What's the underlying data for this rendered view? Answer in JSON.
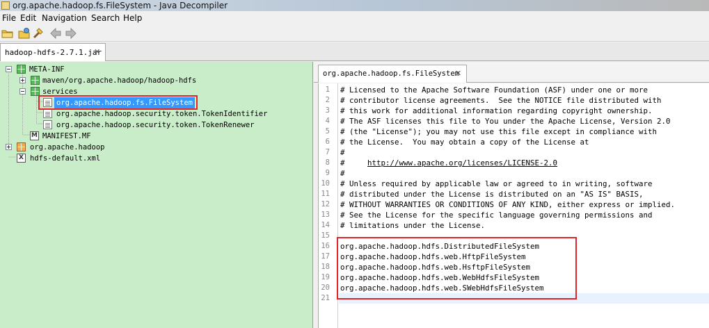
{
  "window": {
    "title": "org.apache.hadoop.fs.FileSystem - Java Decompiler"
  },
  "menu": [
    "File",
    "Edit",
    "Navigation",
    "Search",
    "Help"
  ],
  "toolbar": [
    "open-folder-icon",
    "open-type-icon",
    "search-icon",
    "back-icon",
    "forward-icon"
  ],
  "jar_tab": {
    "label": "hadoop-hdfs-2.7.1.jar",
    "close": "✕"
  },
  "tree": {
    "meta_inf": "META-INF",
    "maven": "maven/org.apache.hadoop/hadoop-hdfs",
    "services": "services",
    "services_items": [
      "org.apache.hadoop.fs.FileSystem",
      "org.apache.hadoop.security.token.TokenIdentifier",
      "org.apache.hadoop.security.token.TokenRenewer"
    ],
    "manifest": "MANIFEST.MF",
    "manifest_badge": "M",
    "org_apache_hadoop": "org.apache.hadoop",
    "hdfs_default": "hdfs-default.xml",
    "xml_badge": "X"
  },
  "editor_tab": {
    "label": "org.apache.hadoop.fs.FileSystem",
    "close": "✕"
  },
  "code_lines": [
    "# Licensed to the Apache Software Foundation (ASF) under one or more",
    "# contributor license agreements.  See the NOTICE file distributed with",
    "# this work for additional information regarding copyright ownership.",
    "# The ASF licenses this file to You under the Apache License, Version 2.0",
    "# (the \"License\"); you may not use this file except in compliance with",
    "# the License.  You may obtain a copy of the License at",
    "#",
    "#     http://www.apache.org/licenses/LICENSE-2.0",
    "#",
    "# Unless required by applicable law or agreed to in writing, software",
    "# distributed under the License is distributed on an \"AS IS\" BASIS,",
    "# WITHOUT WARRANTIES OR CONDITIONS OF ANY KIND, either express or implied.",
    "# See the License for the specific language governing permissions and",
    "# limitations under the License.",
    "",
    "org.apache.hadoop.hdfs.DistributedFileSystem",
    "org.apache.hadoop.hdfs.web.HftpFileSystem",
    "org.apache.hadoop.hdfs.web.HsftpFileSystem",
    "org.apache.hadoop.hdfs.web.WebHdfsFileSystem",
    "org.apache.hadoop.hdfs.web.SWebHdfsFileSystem",
    ""
  ],
  "line_numbers": [
    "1",
    "2",
    "3",
    "4",
    "5",
    "6",
    "7",
    "8",
    "9",
    "10",
    "11",
    "12",
    "13",
    "14",
    "15",
    "16",
    "17",
    "18",
    "19",
    "20",
    "21"
  ],
  "link_url": "http://www.apache.org/licenses/LICENSE-2.0",
  "colors": {
    "tree_bg": "#c9ecc9",
    "selection": "#3399ff",
    "highlight_box": "#e0242a"
  }
}
